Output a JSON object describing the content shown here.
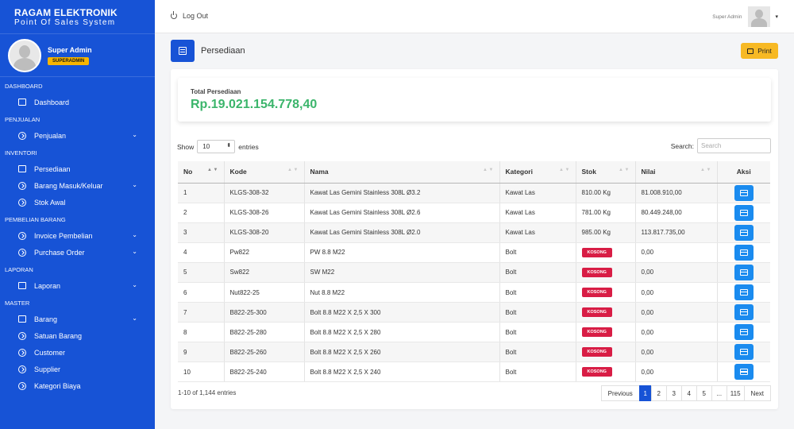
{
  "brand": {
    "name": "RAGAM ELEKTRONIK",
    "subtitle": "Point Of Sales System"
  },
  "profile": {
    "name": "Super Admin",
    "role": "SUPERADMIN"
  },
  "sidebar": {
    "sections": [
      {
        "label": "DASHBOARD",
        "items": [
          {
            "label": "Dashboard",
            "icon": "dashboard-icon"
          }
        ]
      },
      {
        "label": "PENJUALAN",
        "items": [
          {
            "label": "Penjualan",
            "icon": "circle-arrow-icon",
            "expandable": true
          }
        ]
      },
      {
        "label": "INVENTORI",
        "items": [
          {
            "label": "Persediaan",
            "icon": "inventory-icon"
          },
          {
            "label": "Barang Masuk/Keluar",
            "icon": "circle-arrow-icon",
            "expandable": true
          },
          {
            "label": "Stok Awal",
            "icon": "circle-arrow-icon"
          }
        ]
      },
      {
        "label": "PEMBELIAN BARANG",
        "items": [
          {
            "label": "Invoice Pembelian",
            "icon": "circle-arrow-icon",
            "expandable": true
          },
          {
            "label": "Purchase Order",
            "icon": "circle-arrow-icon",
            "expandable": true
          }
        ]
      },
      {
        "label": "LAPORAN",
        "items": [
          {
            "label": "Laporan",
            "icon": "printer-icon",
            "expandable": true
          }
        ]
      },
      {
        "label": "MASTER",
        "items": [
          {
            "label": "Barang",
            "icon": "folder-icon",
            "expandable": true
          },
          {
            "label": "Satuan Barang",
            "icon": "circle-arrow-icon"
          },
          {
            "label": "Customer",
            "icon": "circle-arrow-icon"
          },
          {
            "label": "Supplier",
            "icon": "circle-arrow-icon"
          },
          {
            "label": "Kategori Biaya",
            "icon": "circle-arrow-icon"
          }
        ]
      }
    ]
  },
  "topbar": {
    "logout": "Log Out",
    "user": "Super Admin"
  },
  "page": {
    "title": "Persediaan",
    "print": "Print"
  },
  "summary": {
    "label": "Total Persediaan",
    "value": "Rp.19.021.154.778,40"
  },
  "table_controls": {
    "show": "Show",
    "length": "10",
    "entries": "entries",
    "search_label": "Search:",
    "search_placeholder": "Search"
  },
  "table": {
    "columns": [
      "No",
      "Kode",
      "Nama",
      "Kategori",
      "Stok",
      "Nilai",
      "Aksi"
    ],
    "rows": [
      {
        "no": "1",
        "kode": "KLGS-308-32",
        "nama": "Kawat Las Gemini Stainless 308L Ø3.2",
        "kategori": "Kawat Las",
        "stok": "810.00 Kg",
        "nilai": "81.008.910,00"
      },
      {
        "no": "2",
        "kode": "KLGS-308-26",
        "nama": "Kawat Las Gemini Stainless 308L Ø2.6",
        "kategori": "Kawat Las",
        "stok": "781.00 Kg",
        "nilai": "80.449.248,00"
      },
      {
        "no": "3",
        "kode": "KLGS-308-20",
        "nama": "Kawat Las Gemini Stainless 308L Ø2.0",
        "kategori": "Kawat Las",
        "stok": "985.00 Kg",
        "nilai": "113.817.735,00"
      },
      {
        "no": "4",
        "kode": "Pw822",
        "nama": "PW 8.8 M22",
        "kategori": "Bolt",
        "stok": "KOSONG",
        "nilai": "0,00"
      },
      {
        "no": "5",
        "kode": "Sw822",
        "nama": "SW M22",
        "kategori": "Bolt",
        "stok": "KOSONG",
        "nilai": "0,00"
      },
      {
        "no": "6",
        "kode": "Nut822-25",
        "nama": "Nut 8.8 M22",
        "kategori": "Bolt",
        "stok": "KOSONG",
        "nilai": "0,00"
      },
      {
        "no": "7",
        "kode": "B822-25-300",
        "nama": "Bolt 8.8 M22 X 2,5 X 300",
        "kategori": "Bolt",
        "stok": "KOSONG",
        "nilai": "0,00"
      },
      {
        "no": "8",
        "kode": "B822-25-280",
        "nama": "Bolt 8.8 M22 X 2,5 X 280",
        "kategori": "Bolt",
        "stok": "KOSONG",
        "nilai": "0,00"
      },
      {
        "no": "9",
        "kode": "B822-25-260",
        "nama": "Bolt 8.8 M22 X 2,5 X 260",
        "kategori": "Bolt",
        "stok": "KOSONG",
        "nilai": "0,00"
      },
      {
        "no": "10",
        "kode": "B822-25-240",
        "nama": "Bolt 8.8 M22 X 2,5 X 240",
        "kategori": "Bolt",
        "stok": "KOSONG",
        "nilai": "0,00"
      }
    ]
  },
  "pagination": {
    "info": "1-10 of 1,144 entries",
    "pages": [
      "Previous",
      "1",
      "2",
      "3",
      "4",
      "5",
      "...",
      "115",
      "Next"
    ],
    "active": "1"
  },
  "colors": {
    "sidebar": "#1753d6",
    "accent": "#f7b924",
    "total": "#3bb56b",
    "danger": "#d81d45",
    "action": "#1a8bef"
  }
}
